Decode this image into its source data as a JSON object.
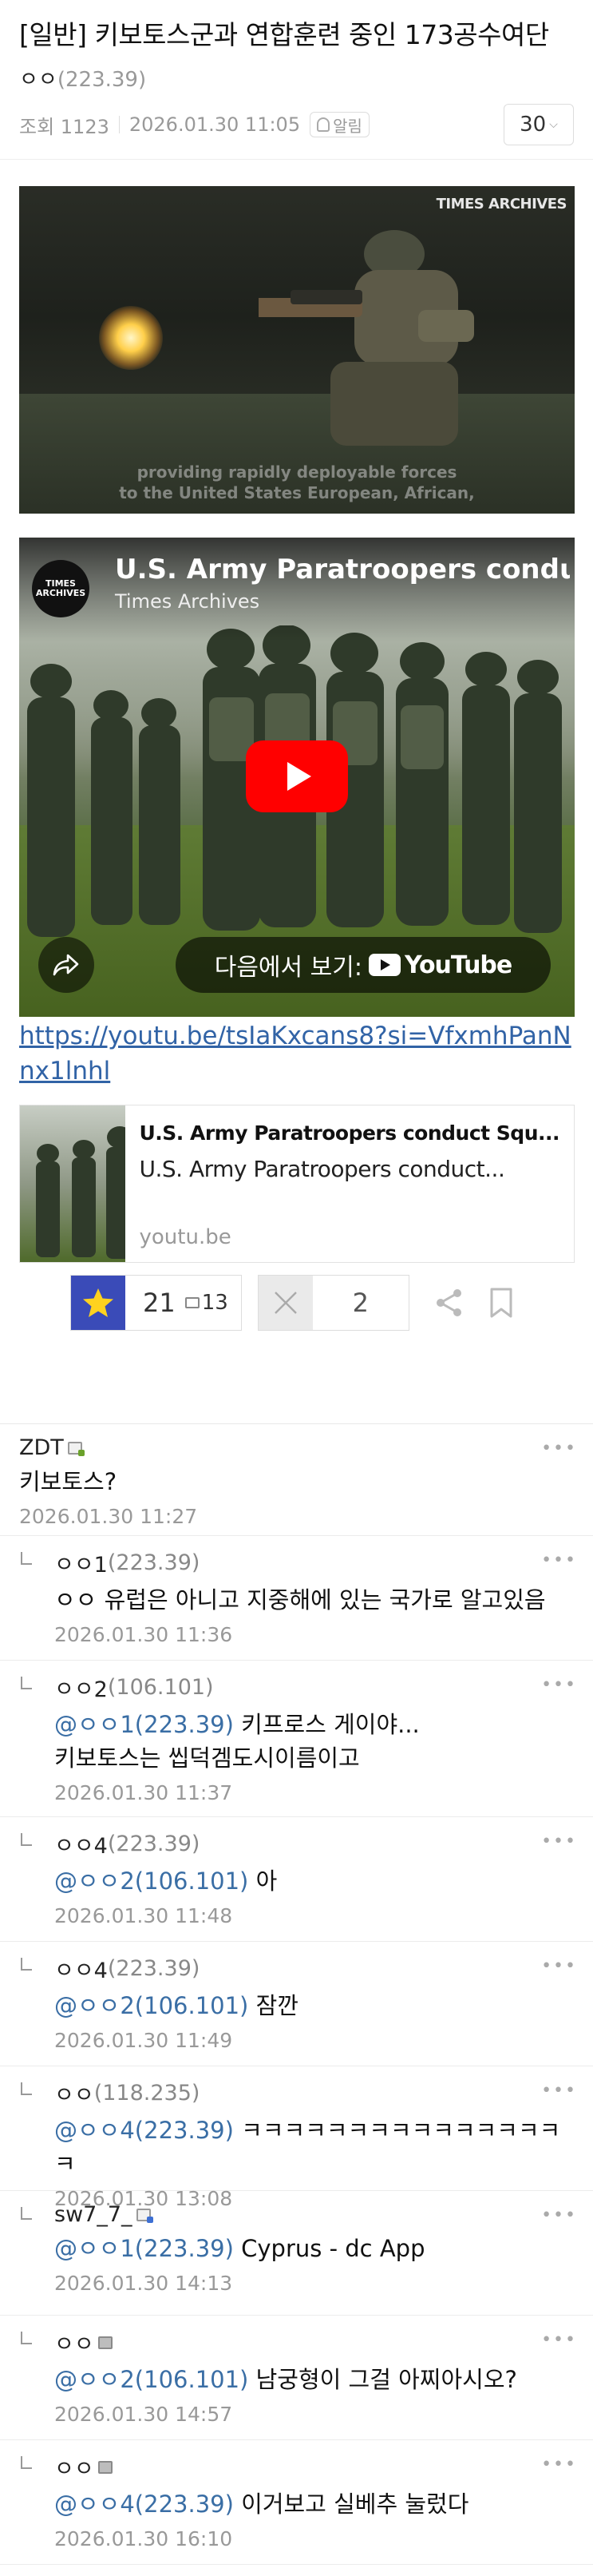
{
  "post": {
    "title": "[일반] 키보토스군과 연합훈련 중인 173공수여단",
    "author_name": "ㅇㅇ",
    "author_ip": "(223.39)",
    "views_label": "조회 1123",
    "datetime": "2026.01.30 11:05",
    "alarm_label": "알림",
    "font_size_value": "30"
  },
  "image1": {
    "watermark": "TIMES ARCHIVES",
    "subtitle_line1": "providing rapidly deployable forces",
    "subtitle_line2": "to the United States European, African,"
  },
  "video": {
    "channel_logo_text": "TIMES ARCHIVES",
    "title": "U.S. Army Paratroopers conduct",
    "channel": "Times Archives",
    "watch_on_label": "다음에서 보기:",
    "youtube_label": "YouTube"
  },
  "link": {
    "url": "https://youtu.be/tsIaKxcans8?si=VfxmhPanNnx1lnhl"
  },
  "og_card": {
    "title": "U.S. Army Paratroopers conduct Squ...",
    "description": "U.S. Army Paratroopers conduct...",
    "domain": "youtu.be"
  },
  "actions": {
    "up_count": "21",
    "fixed_up_count": "13",
    "down_count": "2"
  },
  "comments": [
    {
      "author": "ZDT",
      "ip": "",
      "reply": false,
      "badge": "green",
      "mention": "",
      "text": "키보토스?",
      "time": "2026.01.30 11:27"
    },
    {
      "author": "ㅇㅇ1",
      "ip": "(223.39)",
      "reply": true,
      "badge": "",
      "mention": "",
      "text": "ㅇㅇ 유럽은 아니고 지중해에 있는 국가로 알고있음",
      "time": "2026.01.30 11:36"
    },
    {
      "author": "ㅇㅇ2",
      "ip": "(106.101)",
      "reply": true,
      "badge": "",
      "mention": "@ㅇㅇ1(223.39)",
      "text": " 키프로스 게이야...",
      "text2": "키보토스는 씹덕겜도시이름이고",
      "time": "2026.01.30 11:37"
    },
    {
      "author": "ㅇㅇ4",
      "ip": "(223.39)",
      "reply": true,
      "badge": "",
      "mention": "@ㅇㅇ2(106.101)",
      "text": " 아",
      "time": "2026.01.30 11:48"
    },
    {
      "author": "ㅇㅇ4",
      "ip": "(223.39)",
      "reply": true,
      "badge": "",
      "mention": "@ㅇㅇ2(106.101)",
      "text": " 잠깐",
      "time": "2026.01.30 11:49"
    },
    {
      "author": "ㅇㅇ",
      "ip": "(118.235)",
      "reply": true,
      "badge": "",
      "mention": "@ㅇㅇ4(223.39)",
      "text": " ㅋㅋㅋㅋㅋㅋㅋㅋㅋㅋㅋㅋㅋㅋㅋㅋ",
      "time": "2026.01.30 13:08"
    },
    {
      "author": "sw7_7_",
      "ip": "",
      "reply": true,
      "badge": "blue",
      "mention": "@ㅇㅇ1(223.39)",
      "text": " Cyprus - dc App",
      "time": "2026.01.30 14:13"
    },
    {
      "author": "ㅇㅇ",
      "ip": "",
      "reply": true,
      "badge": "gray",
      "mention": "@ㅇㅇ2(106.101)",
      "text": " 남궁형이 그걸 아찌아시오?",
      "time": "2026.01.30 14:57"
    },
    {
      "author": "ㅇㅇ",
      "ip": "",
      "reply": true,
      "badge": "gray",
      "mention": "@ㅇㅇ4(223.39)",
      "text": " 이거보고 실베추 눌렀다",
      "time": "2026.01.30 16:10"
    }
  ],
  "colors": {
    "accent_blue": "#3a4bb8",
    "link": "#3163a6",
    "mention": "#3a6ea5",
    "youtube_red": "#ff0000"
  }
}
